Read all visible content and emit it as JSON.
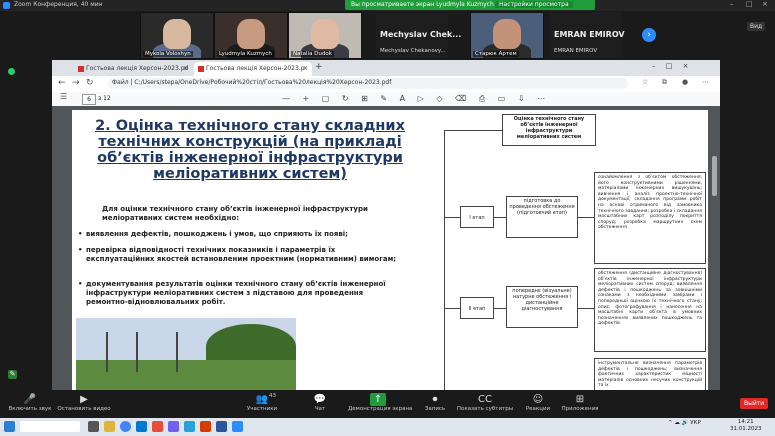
{
  "zoom": {
    "window_title": "Zoom Конференция, 40 мин",
    "share_banner": "Вы просматриваете экран Lyudmyla Kuzmych",
    "share_options": "Настройки просмотра",
    "view_label": "Вид",
    "window_controls": [
      "–",
      "□",
      "×"
    ]
  },
  "participants": [
    {
      "name": "Mykola Voloshyn"
    },
    {
      "name": "Lyudmyla Kuzmych"
    },
    {
      "name": "Natalia Dudok"
    }
  ],
  "name_tiles": [
    {
      "big": "Mechyslav  Chek...",
      "small": "Mechyslav Chekanovy..."
    },
    {
      "big": "",
      "small": "Старюк Артем"
    },
    {
      "big": "EMRAN EMIROV",
      "small": "EMRAN EMIROV"
    }
  ],
  "browser": {
    "tabs": [
      {
        "label": "Гостьова лекція Херсон-2023.pd"
      },
      {
        "label": "Гостьова лекція Херсон-2023.p"
      }
    ],
    "new_tab": "+",
    "url_prefix": "Файл",
    "url": "C:/Users/stepa/OneDrive/Робочий%20стіл/Гостьова%20лекція%20Херсон-2023.pdf",
    "page_current": "6",
    "page_total": "з 12",
    "pdf_tools": "— + ▢ ↻ ⊞ ✎ A ▷ ◇ ⌫ ⎙ ▭ ⇩ ⋯",
    "win_controls": "– □ ×"
  },
  "slide": {
    "title": "2. Оцінка технічного стану складних технічних конструкцій (на прикладі об’єктів інженерної інфраструктури меліоративних систем)",
    "intro": "Для оцінки технічного стану об’єктів інженерної інфраструктури меліоративних систем необхідно:",
    "bullets": [
      "виявлення дефектів, пошкоджень і умов, що сприяють їх появі;",
      "перевірка відповідності технічних показників і параметрів їх експлуатаційних якостей встановленим проектним (нормативним) вимогам;",
      "документування результатів оцінки технічного стану об’єктів інженерної інфраструктури меліоративних систем з підставою для проведення ремонтно-відновлювальних робіт."
    ]
  },
  "diagram": {
    "top": "Оцінка технічного стану об’єктів інженерної інфраструктури меліоративних систем",
    "stage1": "І етап",
    "stage1_desc": "підготовка до проведення обстеження (підготовчий етап)",
    "stage1_list": "ознайомлення з об’єктом обстеження, його конструктивними рішеннями, матеріалами інженерних вишукувань; вивчення і аналіз проектно-технічної документації; складання програми робіт на основі отриманого від замовника технічного завдання; розробка і складання масштабних карт розподілу покриття споруд; розробка маршрутних схем обстеження",
    "stage2": "ІІ етап",
    "stage2_desc": "попереднє (візуальне) натурне обстеження і дистанційне діагностування",
    "stage2_list": "обстеження (дистанційне діагностування) об’єктів інженерної інфраструктури меліоративних систем споруд; виявлення дефектів і пошкоджень за зовнішніми ознаками з необхідними замірами і попередньої оцінкою їх технічного стану; опис, фотографування і нанесення на масштабні карти об’єкта в умовних позначеннях виявлених пошкоджень та дефектів",
    "stage3_list": "інструментальне визначення параметрів дефектів і пошкоджень; визначення фактичних характеристик міцності матеріалів основних несучих конструкцій та їх"
  },
  "controls": [
    {
      "name": "mic",
      "icon": "🎤",
      "label": "Включить звук"
    },
    {
      "name": "video",
      "icon": "▶",
      "label": "Остановить видео"
    },
    {
      "name": "participants",
      "icon": "👥",
      "label": "Участники",
      "count": "43"
    },
    {
      "name": "chat",
      "icon": "💬",
      "label": "Чат"
    },
    {
      "name": "share",
      "icon": "↑",
      "label": "Демонстрация экрана"
    },
    {
      "name": "record",
      "icon": "⏺",
      "label": "Запись"
    },
    {
      "name": "subtitles",
      "icon": "CC",
      "label": "Показать субтитры"
    },
    {
      "name": "reactions",
      "icon": "☺",
      "label": "Реакции"
    },
    {
      "name": "apps",
      "icon": "⊞",
      "label": "Приложения"
    }
  ],
  "end_label": "Выйти",
  "taskbar": {
    "tray": "^ ☁ 🔊 УКР",
    "time": "14:21",
    "date": "31.01.2023"
  },
  "colors": {
    "accent": "#2d8cff",
    "share_green": "#1f9d3a",
    "end_red": "#e02828",
    "slide_title": "#1f3864"
  }
}
